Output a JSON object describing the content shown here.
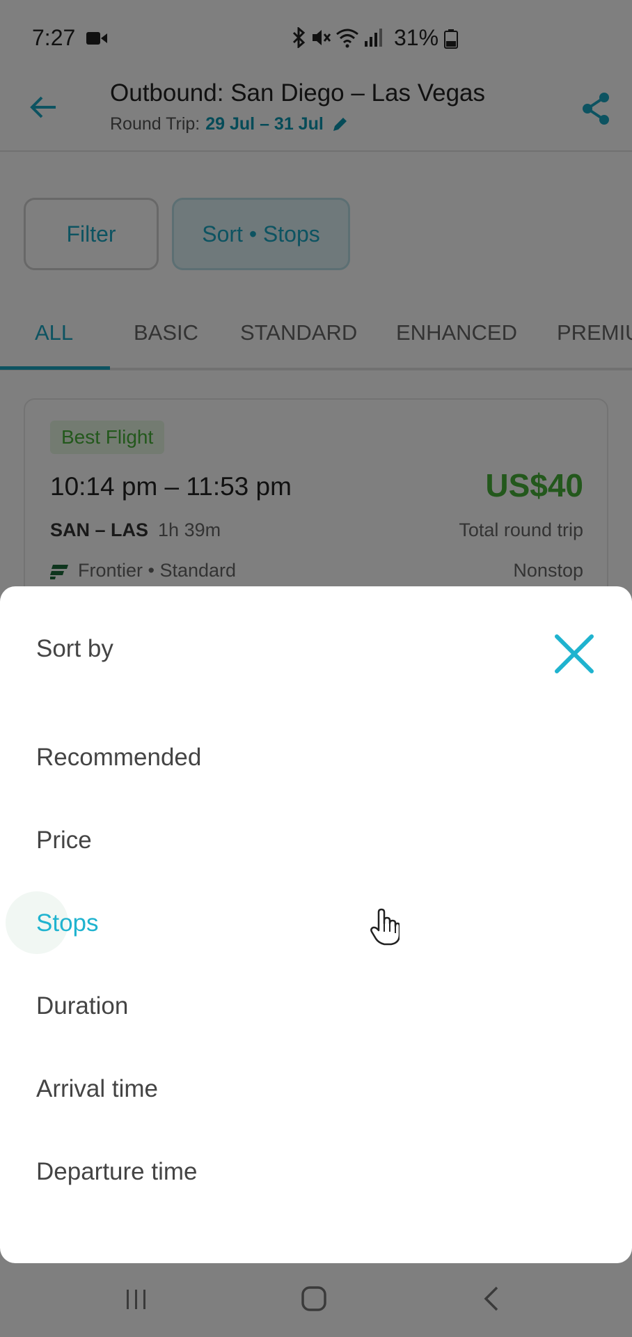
{
  "status_bar": {
    "time": "7:27",
    "battery_percent": "31%",
    "icons": [
      "video-camera-icon",
      "bluetooth-icon",
      "mute-icon",
      "wifi-icon",
      "signal-icon",
      "battery-icon"
    ]
  },
  "header": {
    "title": "Outbound: San Diego – Las Vegas",
    "subtitle_label": "Round Trip:",
    "dates": "29 Jul – 31 Jul",
    "icons": [
      "back-arrow-icon",
      "pencil-icon",
      "share-icon"
    ]
  },
  "chips": {
    "filter_label": "Filter",
    "sort_label": "Sort • Stops"
  },
  "tabs": [
    {
      "label": "ALL",
      "active": true
    },
    {
      "label": "BASIC",
      "active": false
    },
    {
      "label": "STANDARD",
      "active": false
    },
    {
      "label": "ENHANCED",
      "active": false
    },
    {
      "label": "PREMIU",
      "active": false
    }
  ],
  "flight_card": {
    "badge": "Best Flight",
    "times": "10:14 pm – 11:53 pm",
    "price": "US$40",
    "route": "SAN – LAS",
    "duration": "1h 39m",
    "price_note": "Total round trip",
    "airline": "Frontier • Standard",
    "stops": "Nonstop"
  },
  "sort_sheet": {
    "title": "Sort by",
    "options": [
      {
        "label": "Recommended",
        "selected": false
      },
      {
        "label": "Price",
        "selected": false
      },
      {
        "label": "Stops",
        "selected": true
      },
      {
        "label": "Duration",
        "selected": false
      },
      {
        "label": "Arrival time",
        "selected": false
      },
      {
        "label": "Departure time",
        "selected": false
      }
    ]
  },
  "colors": {
    "accent": "#1aa7c2",
    "price_green": "#47b038",
    "overlay": "rgba(0,0,0,0.5)"
  }
}
